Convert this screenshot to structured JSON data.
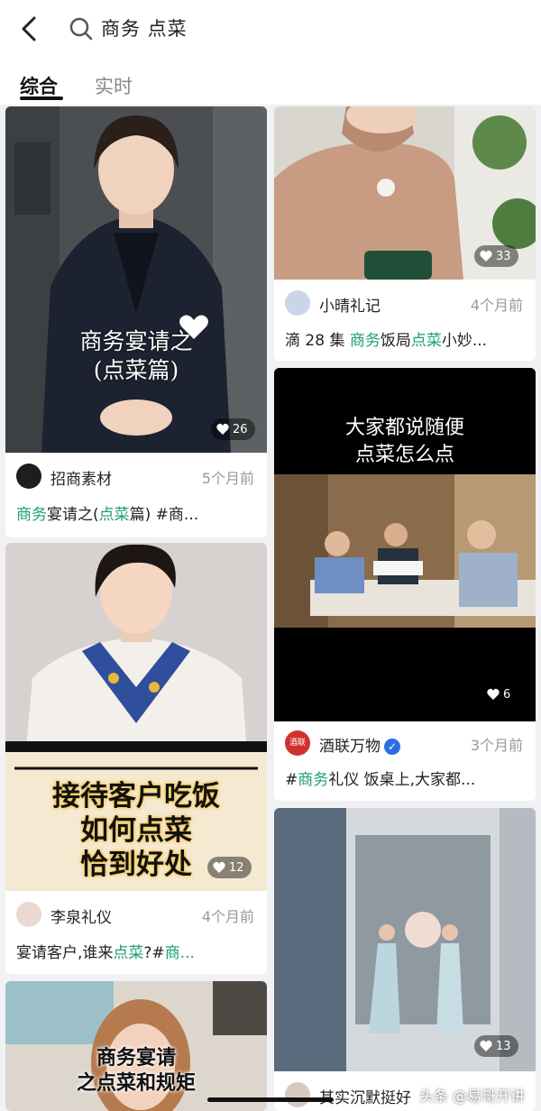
{
  "search": {
    "query": "商务 点菜"
  },
  "tabs": {
    "active": "综合",
    "inactive": "实时"
  },
  "colors": {
    "highlight": "#1aa06b",
    "verified": "#2a6fe0"
  },
  "cards": [
    {
      "overlay_line1": "商务宴请之",
      "overlay_line2": "(点菜篇)",
      "likes": "26",
      "author": "招商素材",
      "time": "5个月前",
      "caption_parts": [
        "商务",
        "宴请之(",
        "点菜",
        "篇) #商..."
      ]
    },
    {
      "likes": "33",
      "author": "小晴礼记",
      "time": "4个月前",
      "caption_parts": [
        "滴 28 集 ",
        "商务",
        "饭局",
        "点菜",
        "小妙..."
      ]
    },
    {
      "overlay_line1": "大家都说随便",
      "overlay_line2": "点菜怎么点",
      "likes": "6",
      "author": "酒联万物",
      "avatar_text": "酒联",
      "time": "3个月前",
      "caption_parts": [
        "#",
        "商务",
        "礼仪 饭桌上,大家都..."
      ]
    },
    {
      "overlay_line1": "接待客户吃饭",
      "overlay_line2": "如何点菜",
      "overlay_line3": "恰到好处",
      "likes": "12",
      "author": "李泉礼仪",
      "time": "4个月前",
      "caption_parts": [
        "宴请客户,谁来",
        "点菜",
        "?#",
        "商..."
      ]
    },
    {
      "likes": "13",
      "author": "其实沉默挺好"
    },
    {
      "overlay_line1": "商务宴请",
      "overlay_line2": "之点菜和规矩"
    }
  ],
  "watermark": "头条 @易哥开讲"
}
